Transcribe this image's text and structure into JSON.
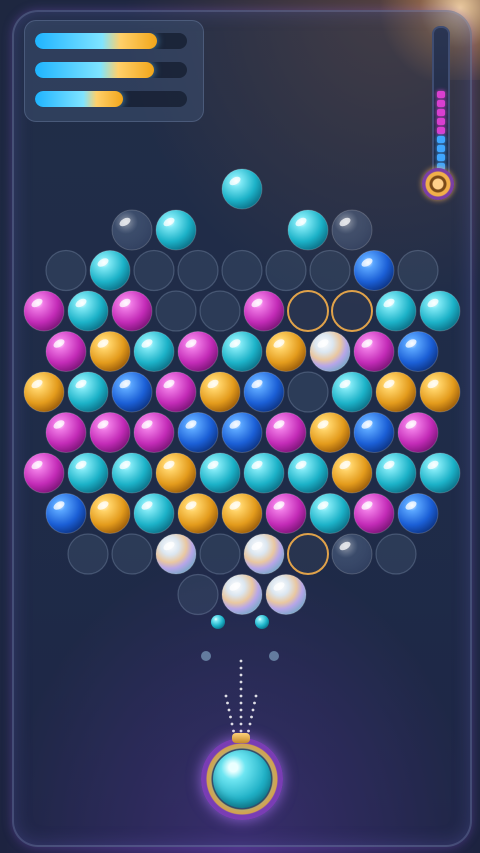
{
  "hud": {
    "progress_bars": [
      {
        "label": "",
        "fill": 0.8
      },
      {
        "label": "",
        "fill": 0.78
      },
      {
        "label": "",
        "fill": 0.58
      }
    ],
    "meter": {
      "segments_lit": 9,
      "segment_colors": [
        "#d93fd0",
        "#d93fd0",
        "#d93fd0",
        "#d93fd0",
        "#d93fd0",
        "#3fa6ff",
        "#3fa6ff",
        "#3fa6ff",
        "#3fa6ff"
      ]
    }
  },
  "colors": {
    "cyan": "#2cc6d8",
    "magenta": "#d53fc9",
    "gold": "#f1b233",
    "blue": "#2270e0",
    "clear": "#9fb7d6",
    "iridescent": "#c9d4e6",
    "ring": "#e0a24a",
    "empty": "#3a4a63"
  },
  "bubbles": [
    {
      "row": -1,
      "col": 4.5,
      "type": "cyan"
    },
    {
      "row": 0,
      "col": 2,
      "type": "clear"
    },
    {
      "row": 0,
      "col": 3,
      "type": "cyan"
    },
    {
      "row": 0,
      "col": 6,
      "type": "cyan"
    },
    {
      "row": 0,
      "col": 7,
      "type": "clear"
    },
    {
      "row": 1,
      "col": 0.5,
      "type": "empty"
    },
    {
      "row": 1,
      "col": 1.5,
      "type": "cyan"
    },
    {
      "row": 1,
      "col": 2.5,
      "type": "empty"
    },
    {
      "row": 1,
      "col": 3.5,
      "type": "empty"
    },
    {
      "row": 1,
      "col": 4.5,
      "type": "empty"
    },
    {
      "row": 1,
      "col": 5.5,
      "type": "empty"
    },
    {
      "row": 1,
      "col": 6.5,
      "type": "empty"
    },
    {
      "row": 1,
      "col": 7.5,
      "type": "blue"
    },
    {
      "row": 1,
      "col": 8.5,
      "type": "empty"
    },
    {
      "row": 2,
      "col": 0,
      "type": "magenta"
    },
    {
      "row": 2,
      "col": 1,
      "type": "cyan"
    },
    {
      "row": 2,
      "col": 2,
      "type": "magenta"
    },
    {
      "row": 2,
      "col": 3,
      "type": "empty"
    },
    {
      "row": 2,
      "col": 4,
      "type": "empty"
    },
    {
      "row": 2,
      "col": 5,
      "type": "magenta"
    },
    {
      "row": 2,
      "col": 6,
      "type": "ring"
    },
    {
      "row": 2,
      "col": 7,
      "type": "ring"
    },
    {
      "row": 2,
      "col": 8,
      "type": "cyan"
    },
    {
      "row": 2,
      "col": 9,
      "type": "cyan"
    },
    {
      "row": 3,
      "col": 0.5,
      "type": "magenta"
    },
    {
      "row": 3,
      "col": 1.5,
      "type": "gold"
    },
    {
      "row": 3,
      "col": 2.5,
      "type": "cyan"
    },
    {
      "row": 3,
      "col": 3.5,
      "type": "magenta"
    },
    {
      "row": 3,
      "col": 4.5,
      "type": "cyan"
    },
    {
      "row": 3,
      "col": 5.5,
      "type": "gold"
    },
    {
      "row": 3,
      "col": 6.5,
      "type": "iridescent"
    },
    {
      "row": 3,
      "col": 7.5,
      "type": "magenta"
    },
    {
      "row": 3,
      "col": 8.5,
      "type": "blue"
    },
    {
      "row": 4,
      "col": 0,
      "type": "gold"
    },
    {
      "row": 4,
      "col": 1,
      "type": "cyan"
    },
    {
      "row": 4,
      "col": 2,
      "type": "blue"
    },
    {
      "row": 4,
      "col": 3,
      "type": "magenta"
    },
    {
      "row": 4,
      "col": 4,
      "type": "gold"
    },
    {
      "row": 4,
      "col": 5,
      "type": "blue"
    },
    {
      "row": 4,
      "col": 6,
      "type": "empty"
    },
    {
      "row": 4,
      "col": 7,
      "type": "cyan"
    },
    {
      "row": 4,
      "col": 8,
      "type": "gold"
    },
    {
      "row": 4,
      "col": 9,
      "type": "gold"
    },
    {
      "row": 5,
      "col": 0.5,
      "type": "magenta"
    },
    {
      "row": 5,
      "col": 1.5,
      "type": "magenta"
    },
    {
      "row": 5,
      "col": 2.5,
      "type": "magenta"
    },
    {
      "row": 5,
      "col": 3.5,
      "type": "blue"
    },
    {
      "row": 5,
      "col": 4.5,
      "type": "blue"
    },
    {
      "row": 5,
      "col": 5.5,
      "type": "magenta"
    },
    {
      "row": 5,
      "col": 6.5,
      "type": "gold"
    },
    {
      "row": 5,
      "col": 7.5,
      "type": "blue"
    },
    {
      "row": 5,
      "col": 8.5,
      "type": "magenta"
    },
    {
      "row": 6,
      "col": 0,
      "type": "magenta"
    },
    {
      "row": 6,
      "col": 1,
      "type": "cyan"
    },
    {
      "row": 6,
      "col": 2,
      "type": "cyan"
    },
    {
      "row": 6,
      "col": 3,
      "type": "gold"
    },
    {
      "row": 6,
      "col": 4,
      "type": "cyan"
    },
    {
      "row": 6,
      "col": 5,
      "type": "cyan"
    },
    {
      "row": 6,
      "col": 6,
      "type": "cyan"
    },
    {
      "row": 6,
      "col": 7,
      "type": "gold"
    },
    {
      "row": 6,
      "col": 8,
      "type": "cyan"
    },
    {
      "row": 6,
      "col": 9,
      "type": "cyan"
    },
    {
      "row": 7,
      "col": 0.5,
      "type": "blue"
    },
    {
      "row": 7,
      "col": 1.5,
      "type": "gold"
    },
    {
      "row": 7,
      "col": 2.5,
      "type": "cyan"
    },
    {
      "row": 7,
      "col": 3.5,
      "type": "gold"
    },
    {
      "row": 7,
      "col": 4.5,
      "type": "gold"
    },
    {
      "row": 7,
      "col": 5.5,
      "type": "magenta"
    },
    {
      "row": 7,
      "col": 6.5,
      "type": "cyan"
    },
    {
      "row": 7,
      "col": 7.5,
      "type": "magenta"
    },
    {
      "row": 7,
      "col": 8.5,
      "type": "blue"
    },
    {
      "row": 8,
      "col": 1,
      "type": "empty"
    },
    {
      "row": 8,
      "col": 2,
      "type": "empty"
    },
    {
      "row": 8,
      "col": 3,
      "type": "iridescent"
    },
    {
      "row": 8,
      "col": 4,
      "type": "empty"
    },
    {
      "row": 8,
      "col": 5,
      "type": "iridescent"
    },
    {
      "row": 8,
      "col": 6,
      "type": "ring"
    },
    {
      "row": 8,
      "col": 7,
      "type": "clear"
    },
    {
      "row": 8,
      "col": 8,
      "type": "empty"
    },
    {
      "row": 9,
      "col": 3.5,
      "type": "empty"
    },
    {
      "row": 9,
      "col": 4.5,
      "type": "iridescent"
    },
    {
      "row": 9,
      "col": 5.5,
      "type": "iridescent"
    }
  ],
  "aim_dots": 12
}
